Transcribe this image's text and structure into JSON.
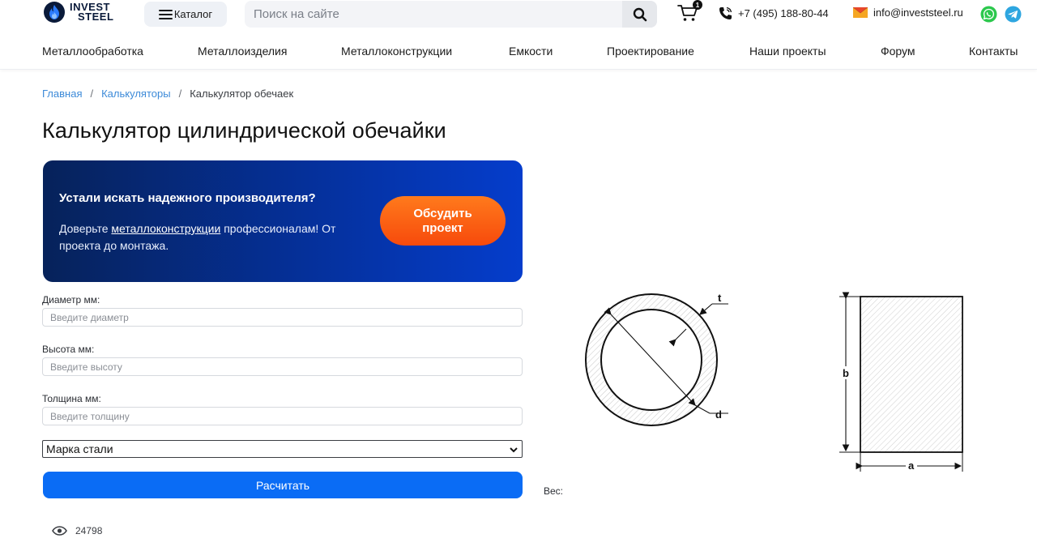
{
  "header": {
    "logo": {
      "line1": "INVEST",
      "line2": "STEEL"
    },
    "catalog_label": "Каталог",
    "search_placeholder": "Поиск на сайте",
    "cart_count": "1",
    "phone": "+7 (495) 188-80-44",
    "email": "info@investsteel.ru"
  },
  "nav": {
    "items": [
      "Металлообработка",
      "Металлоизделия",
      "Металлоконструкции",
      "Емкости",
      "Проектирование",
      "Наши проекты",
      "Форум",
      "Контакты"
    ]
  },
  "breadcrumb": {
    "home": "Главная",
    "calculators": "Калькуляторы",
    "current": "Калькулятор обечаек",
    "separator": "/"
  },
  "page_title": "Калькулятор цилиндрической обечайки",
  "promo": {
    "title": "Устали искать надежного производителя?",
    "text_before": "Доверьте ",
    "link": "металлоконструкции",
    "text_after": " профессионалам! От проекта до монтажа.",
    "button_line1": "Обсудить",
    "button_line2": "проект"
  },
  "form": {
    "diameter_label": "Диаметр мм:",
    "diameter_placeholder": "Введите диаметр",
    "height_label": "Высота мм:",
    "height_placeholder": "Введите высоту",
    "thickness_label": "Толщина мм:",
    "thickness_placeholder": "Введите толщину",
    "steel_select": "Марка стали",
    "submit_label": "Расчитать"
  },
  "result": {
    "weight_label": "Вес:"
  },
  "diagram": {
    "circle_labels": {
      "thickness": "t",
      "diameter": "d"
    },
    "rect_labels": {
      "height": "b",
      "width": "a"
    }
  },
  "views_count": "24798",
  "colors": {
    "accent_blue": "#0a6cf5",
    "promo_orange": "#f74a0c",
    "link_blue": "#3c8ad8",
    "promo_dark": "#06225a"
  }
}
